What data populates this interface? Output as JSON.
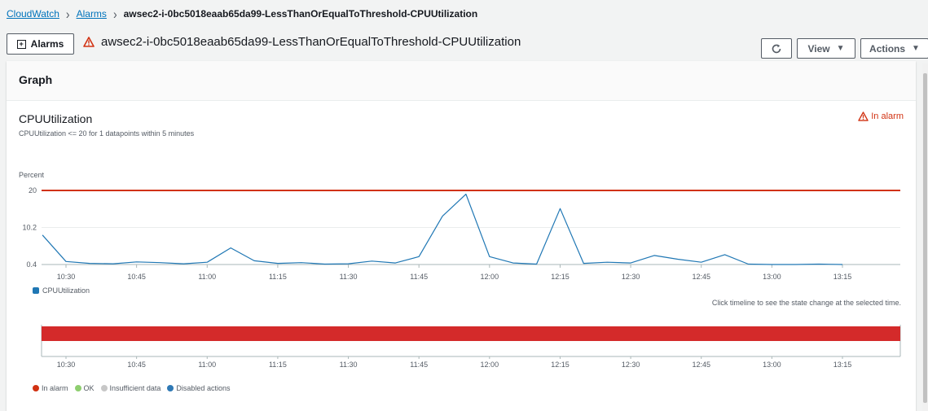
{
  "breadcrumb": {
    "items": [
      "CloudWatch",
      "Alarms"
    ],
    "current": "awsec2-i-0bc5018eaab65da99-LessThanOrEqualToThreshold-CPUUtilization"
  },
  "header": {
    "alarms_button": "Alarms",
    "title": "awsec2-i-0bc5018eaab65da99-LessThanOrEqualToThreshold-CPUUtilization",
    "view_button": "View",
    "actions_button": "Actions"
  },
  "panel": {
    "title": "Graph",
    "metric_title": "CPUUtilization",
    "metric_subtitle": "CPUUtilization <= 20 for 1 datapoints within 5 minutes",
    "state": "In alarm",
    "y_label": "Percent",
    "series_legend": "CPUUtilization",
    "timeline_hint": "Click timeline to see the state change at the selected time.",
    "state_legend": [
      {
        "label": "In alarm",
        "color": "#d13212"
      },
      {
        "label": "OK",
        "color": "#8ece6f"
      },
      {
        "label": "Insufficient data",
        "color": "#c7c7c7"
      },
      {
        "label": "Disabled actions",
        "color": "#2f79b5"
      }
    ]
  },
  "colors": {
    "threshold": "#d13212",
    "series": "#1f77b4",
    "alarm_bar": "#d42a2a",
    "link": "#0073bb"
  },
  "chart_data": {
    "type": "line",
    "y_ticks": [
      "20",
      "10.2",
      "0.4"
    ],
    "x_ticks": [
      "10:30",
      "10:45",
      "11:00",
      "11:15",
      "11:30",
      "11:45",
      "12:00",
      "12:15",
      "12:30",
      "12:45",
      "13:00",
      "13:15"
    ],
    "ylim": [
      0.4,
      20
    ],
    "threshold": 20,
    "series": [
      {
        "name": "CPUUtilization",
        "x": [
          "10:25",
          "10:30",
          "10:35",
          "10:40",
          "10:45",
          "10:50",
          "10:55",
          "11:00",
          "11:05",
          "11:10",
          "11:15",
          "11:20",
          "11:25",
          "11:30",
          "11:35",
          "11:40",
          "11:45",
          "11:50",
          "11:55",
          "12:00",
          "12:05",
          "12:10",
          "12:15",
          "12:20",
          "12:25",
          "12:30",
          "12:35",
          "12:40",
          "12:45",
          "12:50",
          "12:55",
          "13:00",
          "13:05",
          "13:10",
          "13:15"
        ],
        "values": [
          8.2,
          1.2,
          0.7,
          0.6,
          1.1,
          0.9,
          0.6,
          1.0,
          4.8,
          1.4,
          0.7,
          0.9,
          0.5,
          0.6,
          1.3,
          0.8,
          2.5,
          13.2,
          19.0,
          2.5,
          0.8,
          0.5,
          15.2,
          0.7,
          1.0,
          0.8,
          2.8,
          1.8,
          1.0,
          3.0,
          0.5,
          0.4,
          0.4,
          0.5,
          0.4
        ]
      }
    ],
    "timeline": {
      "state": "In alarm"
    }
  }
}
